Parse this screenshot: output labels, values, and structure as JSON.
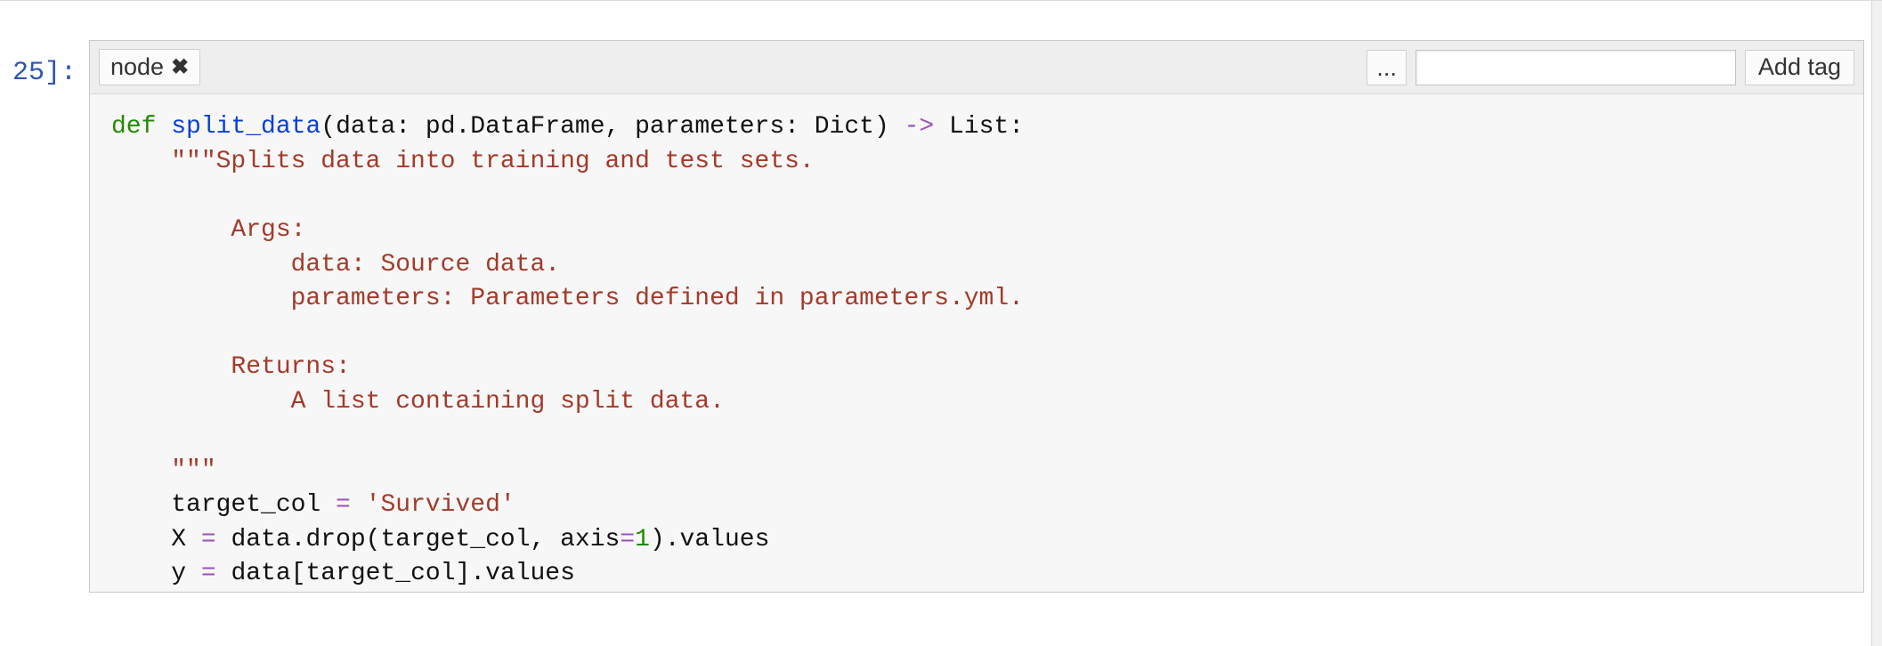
{
  "prompt": {
    "label": "25]:"
  },
  "tagbar": {
    "tags": [
      {
        "label": "node"
      }
    ],
    "ellipsis_label": "...",
    "input_value": "",
    "input_placeholder": "",
    "add_tag_label": "Add tag"
  },
  "code": {
    "kw_def": "def",
    "fn_name": "split_data",
    "sig_open": "(data: pd.DataFrame, parameters: Dict) ",
    "arrow": "->",
    "sig_close": " List:",
    "doc_open": "    \"\"\"Splits data into training and test sets.",
    "doc_blank1": "",
    "doc_args_hdr": "        Args:",
    "doc_args_l1": "            data: Source data.",
    "doc_args_l2": "            parameters: Parameters defined in parameters.yml.",
    "doc_blank2": "",
    "doc_ret_hdr": "        Returns:",
    "doc_ret_l1": "            A list containing split data.",
    "doc_blank3": "",
    "doc_close": "    \"\"\"",
    "l_target_lhs": "    target_col ",
    "eq1": "=",
    "l_target_rhs_sp": " ",
    "l_target_str": "'Survived'",
    "l_x_lhs": "    X ",
    "eq2": "=",
    "l_x_mid": " data.drop(target_col, axis",
    "eq3": "=",
    "num1": "1",
    "l_x_tail": ").values",
    "l_y_lhs": "    y ",
    "eq4": "=",
    "l_y_rhs": " data[target_col].values"
  }
}
